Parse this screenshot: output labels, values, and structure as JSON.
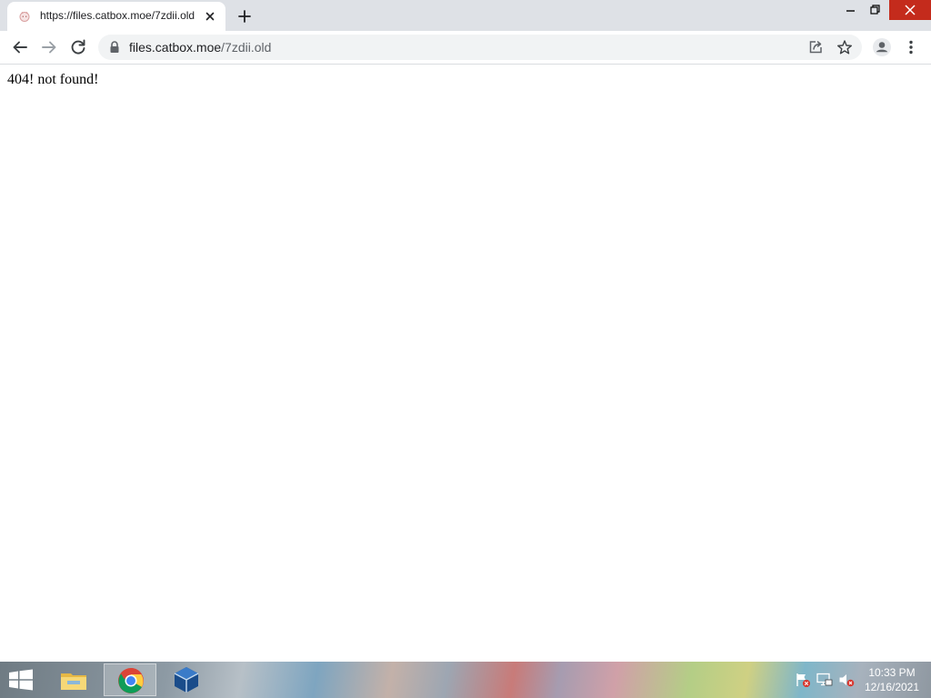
{
  "browser": {
    "tab": {
      "title": "https://files.catbox.moe/7zdii.old"
    },
    "address": {
      "host": "files.catbox.moe",
      "path": "/7zdii.old"
    },
    "accent_colors": {
      "close_button": "#c42b1c",
      "tabstrip": "#dee1e6",
      "omnibox": "#f1f3f4"
    }
  },
  "page": {
    "message": "404! not found!"
  },
  "taskbar": {
    "apps": [
      {
        "icon": "file-explorer-icon"
      },
      {
        "icon": "chrome-icon",
        "active": true
      },
      {
        "icon": "virtualbox-icon"
      }
    ],
    "tray_icons": [
      "action-center-flag-icon",
      "network-icon",
      "volume-muted-icon"
    ],
    "clock": {
      "time": "10:33 PM",
      "date": "12/16/2021"
    }
  }
}
